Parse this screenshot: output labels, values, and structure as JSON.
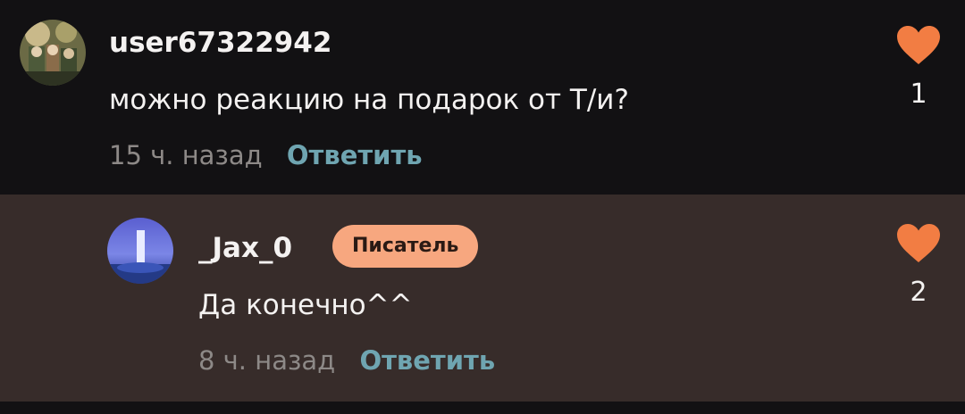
{
  "comments": [
    {
      "username": "user67322942",
      "text": "можно реакцию на подарок от Т/и?",
      "time": "15 ч. назад",
      "reply_label": "Ответить",
      "likes": "1"
    }
  ],
  "reply": {
    "username": "_Jax_0",
    "badge": "Писатель",
    "text": "Да конечно^^",
    "time": "8 ч. назад",
    "reply_label": "Ответить",
    "likes": "2"
  },
  "colors": {
    "background": "#121113",
    "reply_background": "#372c2a",
    "accent_heart": "#f27d43",
    "reply_link": "#6fa5b1",
    "badge": "#f7a77f"
  },
  "icons": {
    "like": "heart-icon"
  }
}
